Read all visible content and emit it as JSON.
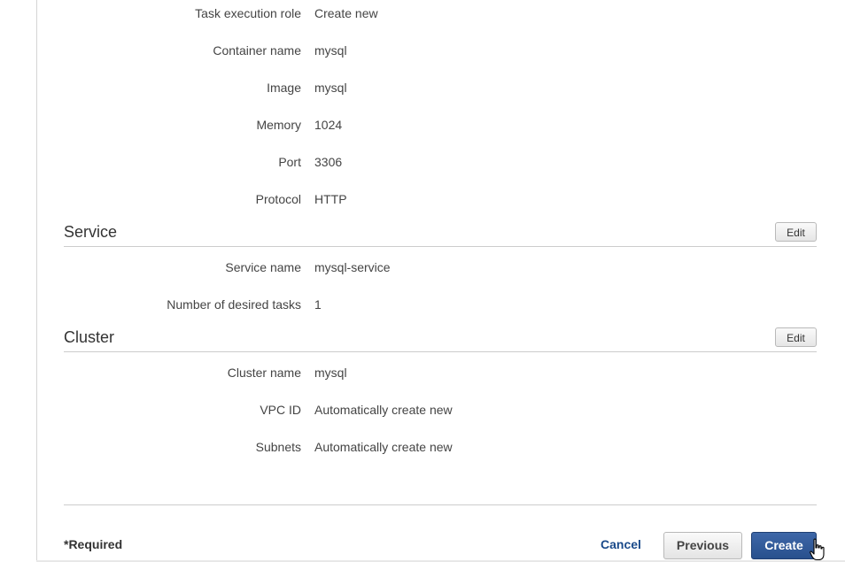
{
  "task_definition": {
    "rows": [
      {
        "label": "Task execution role",
        "value": "Create new"
      },
      {
        "label": "Container name",
        "value": "mysql"
      },
      {
        "label": "Image",
        "value": "mysql"
      },
      {
        "label": "Memory",
        "value": "1024"
      },
      {
        "label": "Port",
        "value": "3306"
      },
      {
        "label": "Protocol",
        "value": "HTTP"
      }
    ]
  },
  "service": {
    "title": "Service",
    "edit_label": "Edit",
    "rows": [
      {
        "label": "Service name",
        "value": "mysql-service"
      },
      {
        "label": "Number of desired tasks",
        "value": "1"
      }
    ]
  },
  "cluster": {
    "title": "Cluster",
    "edit_label": "Edit",
    "rows": [
      {
        "label": "Cluster name",
        "value": "mysql"
      },
      {
        "label": "VPC ID",
        "value": "Automatically create new"
      },
      {
        "label": "Subnets",
        "value": "Automatically create new"
      }
    ]
  },
  "footer": {
    "required_note": "*Required",
    "cancel_label": "Cancel",
    "previous_label": "Previous",
    "create_label": "Create"
  },
  "icons": {
    "cursor": "hand-pointer-icon"
  },
  "colors": {
    "primary_button": "#28508d",
    "link": "#1a4a8a"
  }
}
